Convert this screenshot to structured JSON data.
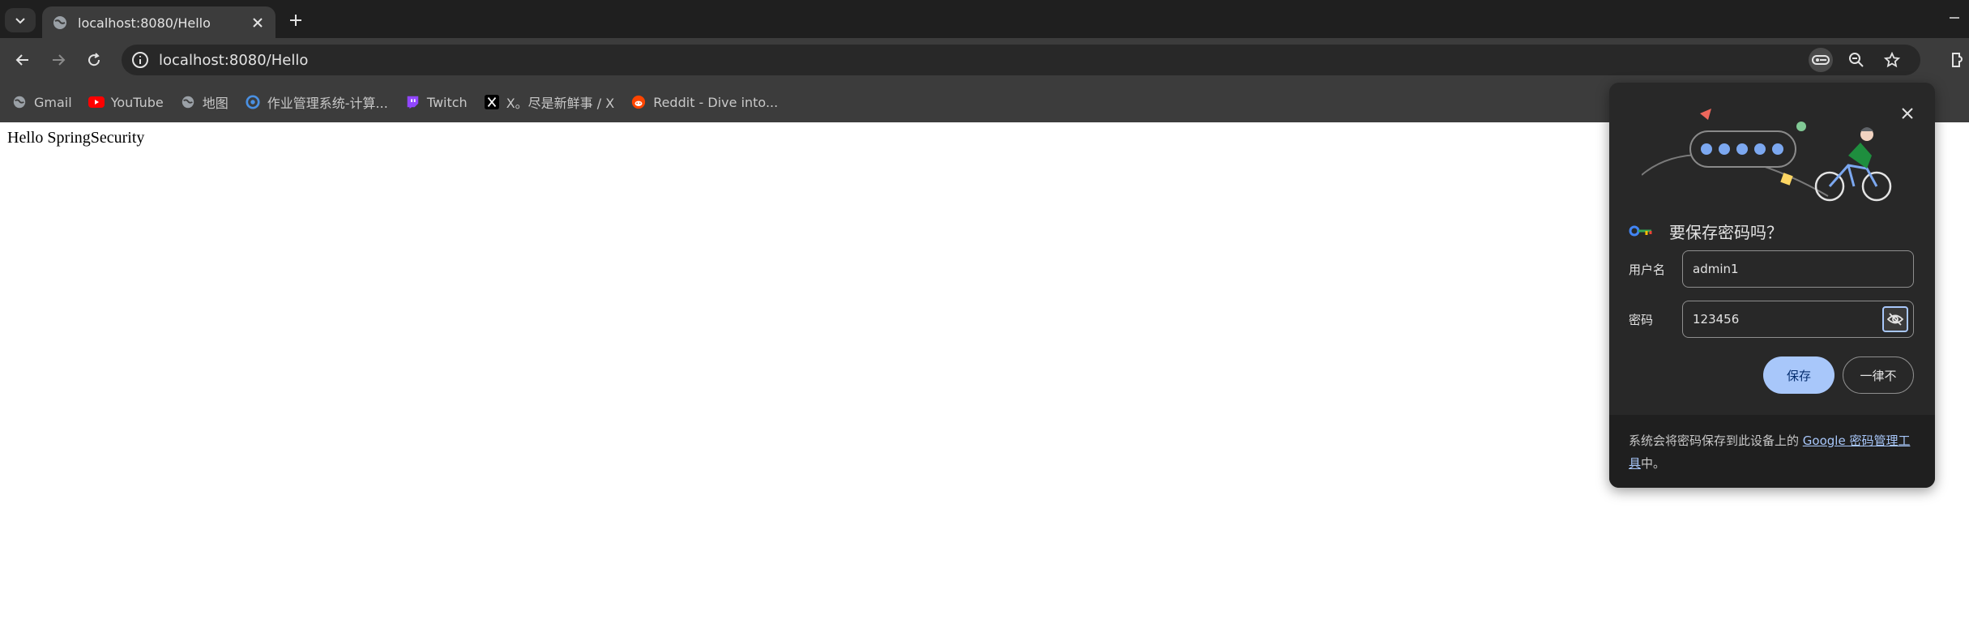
{
  "tab": {
    "title": "localhost:8080/Hello",
    "favicon": "globe-icon"
  },
  "omnibox": {
    "url": "localhost:8080/Hello"
  },
  "bookmarks": [
    {
      "label": "Gmail",
      "icon": "globe-icon"
    },
    {
      "label": "YouTube",
      "icon": "youtube-icon"
    },
    {
      "label": "地图",
      "icon": "globe-icon"
    },
    {
      "label": "作业管理系统-计算...",
      "icon": "app-icon"
    },
    {
      "label": "Twitch",
      "icon": "twitch-icon"
    },
    {
      "label": "X。尽是新鲜事 / X",
      "icon": "x-icon"
    },
    {
      "label": "Reddit - Dive into...",
      "icon": "reddit-icon"
    }
  ],
  "page": {
    "body_text": "Hello SpringSecurity"
  },
  "password_popup": {
    "heading": "要保存密码吗？",
    "username_label": "用户名",
    "username_value": "admin1",
    "password_label": "密码",
    "password_value": "123456",
    "save_label": "保存",
    "never_label": "一律不",
    "footer_prefix": "系统会将密码保存到此设备上的 ",
    "footer_link": "Google 密码管理工具",
    "footer_suffix": "中。"
  },
  "colors": {
    "accent": "#a8c7fa",
    "popup_bg": "#282828",
    "toolbar_bg": "#3c3c3c",
    "tabstrip_bg": "#1f1f1f"
  }
}
